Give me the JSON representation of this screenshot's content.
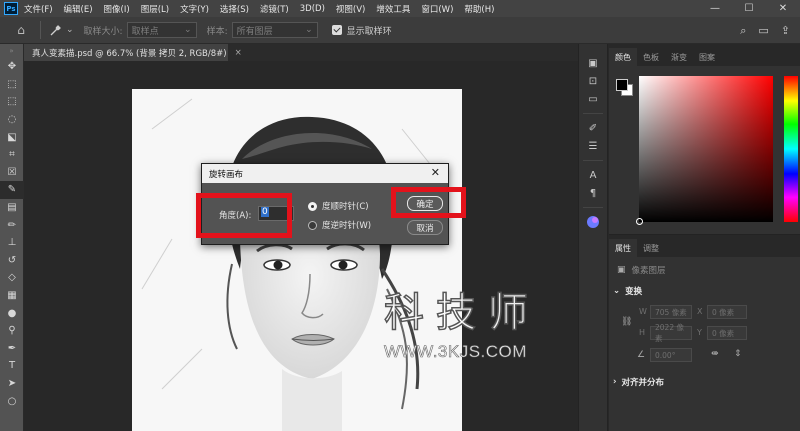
{
  "menubar": {
    "logo": "Ps",
    "items": [
      "文件(F)",
      "编辑(E)",
      "图像(I)",
      "图层(L)",
      "文字(Y)",
      "选择(S)",
      "滤镜(T)",
      "3D(D)",
      "视图(V)",
      "增效工具",
      "窗口(W)",
      "帮助(H)"
    ],
    "minimize": "—",
    "maximize": "☐",
    "close": "✕"
  },
  "options": {
    "sample_size_label": "取样大小:",
    "sample_size_value": "取样点",
    "sample_label": "样本:",
    "sample_value": "所有图层",
    "show_ring_label": "显示取样环"
  },
  "document_tab": {
    "title": "真人变素描.psd @ 66.7% (背景 拷贝 2, RGB/8#)",
    "close": "×"
  },
  "dialog": {
    "title": "旋转画布",
    "close": "✕",
    "angle_label": "角度(A):",
    "angle_value": "0",
    "option_cw": "度顺时针(C)",
    "option_ccw": "度逆时针(W)",
    "selected_option": "cw",
    "ok_label": "确定",
    "cancel_label": "取消",
    "highlight_color": "#e3121b"
  },
  "watermark": {
    "chars": [
      "科",
      "技",
      "师"
    ],
    "url": "WWW.3KJS.COM"
  },
  "color_panel": {
    "tabs": [
      "颜色",
      "色板",
      "渐变",
      "图案"
    ],
    "foreground": "#000000",
    "background": "#ffffff",
    "hue": "#ff0000"
  },
  "properties_panel": {
    "tabs": [
      "属性",
      "调整"
    ],
    "layer_type": "像素图层",
    "transform_label": "变换",
    "w_label": "W",
    "w_value": "705 像素",
    "h_label": "H",
    "h_value": "2022 像素",
    "x_label": "X",
    "x_value": "0 像素",
    "y_label": "Y",
    "y_value": "0 像素",
    "angle_value": "0.00°",
    "align_label": "对齐并分布"
  }
}
